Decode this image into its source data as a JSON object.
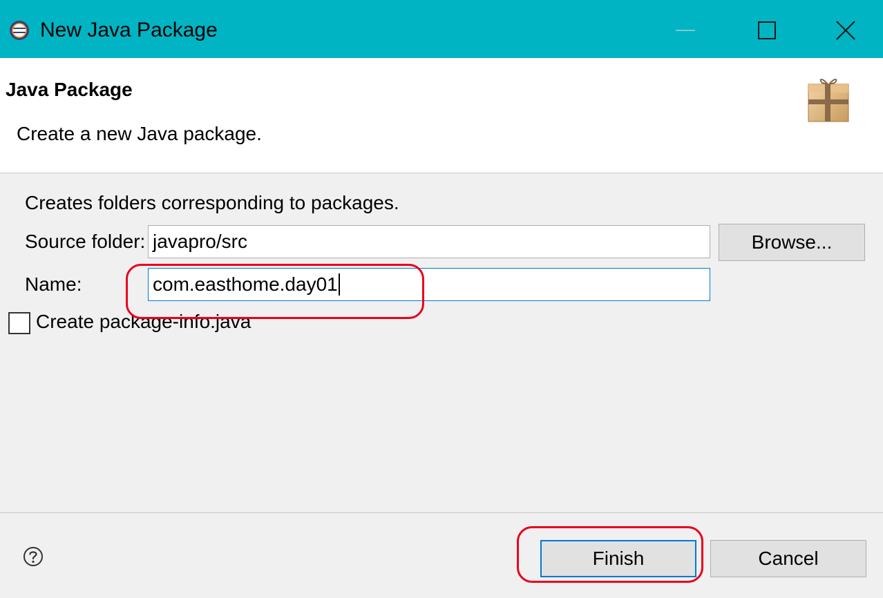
{
  "window": {
    "title": "New Java Package",
    "title_bar_color": "#00b4c3"
  },
  "header": {
    "title": "Java Package",
    "description": "Create a new Java package.",
    "icon": "package-icon"
  },
  "form": {
    "hint": "Creates folders corresponding to packages.",
    "source_folder_label": "Source folder:",
    "source_folder_value": "javapro/src",
    "browse_label": "Browse...",
    "name_label": "Name:",
    "name_value": "com.easthome.day01",
    "checkbox_label": "Create package-info.java",
    "checkbox_checked": false
  },
  "footer": {
    "finish_label": "Finish",
    "cancel_label": "Cancel",
    "help_icon": "help-icon"
  },
  "annotation_color": "#e8001c",
  "focus_color": "#0078d7"
}
